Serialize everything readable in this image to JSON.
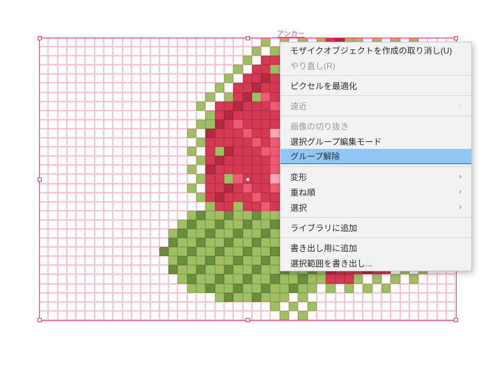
{
  "anchor_label": "アンカー",
  "menu": {
    "undo_mosaic": "モザイクオブジェクトを作成の取り消し(U)",
    "redo": "やり直し(R)",
    "pixel_optimize": "ピクセルを最適化",
    "perspective": "遠近",
    "crop_image": "画像の切り抜き",
    "isolation_mode": "選択グループ編集モード",
    "ungroup": "グループ解除",
    "transform": "変形",
    "arrange": "重ね順",
    "select": "選択",
    "add_to_library": "ライブラリに追加",
    "add_for_export": "書き出し用に追加",
    "export_selection": "選択範囲を書き出し..."
  },
  "colors": {
    "selection": "#ff3b6f",
    "menu_highlight": "#8fc8f6",
    "menu_bg": "#f2f2f2"
  },
  "mosaic": {
    "rows": 31,
    "cols": 45
  }
}
